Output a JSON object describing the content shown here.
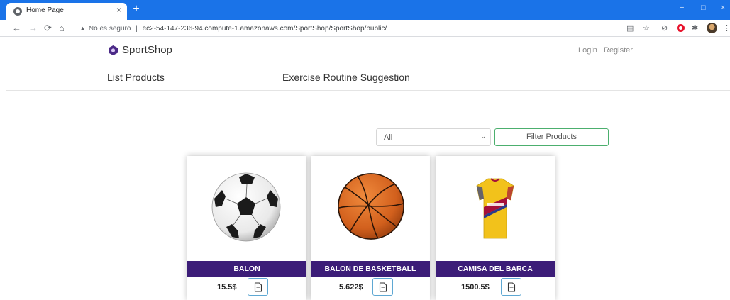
{
  "browser": {
    "tab_title": "Home Page",
    "tab_close": "×",
    "new_tab": "+",
    "security_warning": "No es seguro",
    "separator": "|",
    "url": "ec2-54-147-236-94.compute-1.amazonaws.com/SportShop/SportShop/public/",
    "window_controls": [
      "−",
      "□",
      "×"
    ]
  },
  "site": {
    "brand": "SportShop",
    "login": "Login",
    "register": "Register",
    "nav": [
      "List Products",
      "Exercise Routine Suggestion"
    ]
  },
  "filter": {
    "selected": "All",
    "button_label": "Filter Products"
  },
  "products": [
    {
      "name": "BALON",
      "price": "15.5$",
      "image": "soccer-ball"
    },
    {
      "name": "BALON DE BASKETBALL",
      "price": "5.622$",
      "image": "basketball"
    },
    {
      "name": "CAMISA DEL BARCA",
      "price": "1500.5$",
      "image": "barca-jersey"
    }
  ],
  "colors": {
    "chrome_blue": "#1a73e8",
    "card_title_bg": "#3c1d78",
    "filter_border": "#4caf6e",
    "detail_border": "#5fa8d3"
  }
}
